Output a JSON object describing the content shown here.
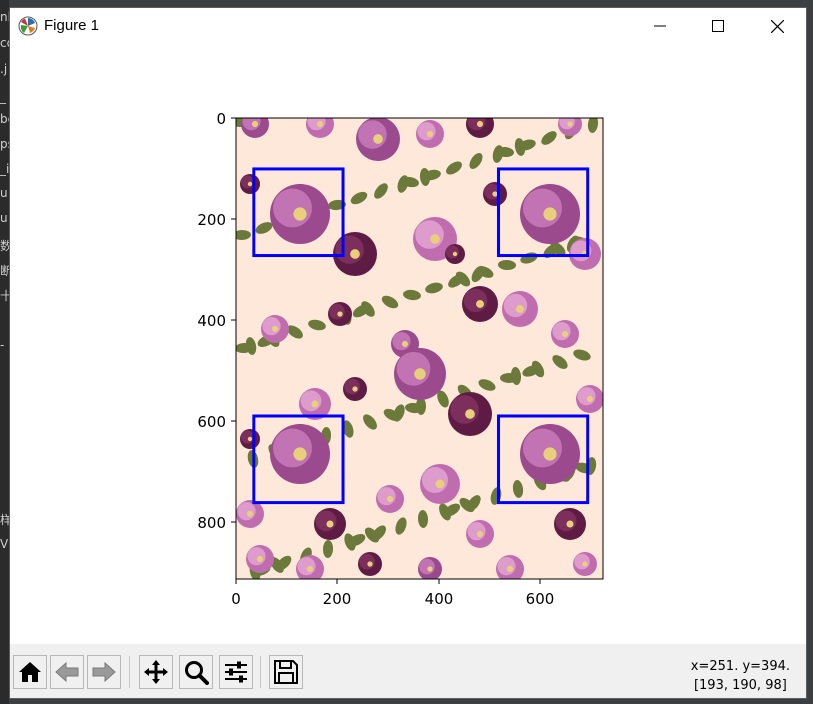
{
  "window": {
    "title": "Figure 1",
    "controls": {
      "minimize": "minimize",
      "maximize": "maximize",
      "close": "close"
    }
  },
  "background": {
    "left_fragments": [
      "nl",
      "co",
      ".j",
      "_",
      "be",
      "ps",
      "_i",
      "u",
      "u",
      "数",
      "断",
      "十",
      "-",
      "样",
      "V"
    ]
  },
  "toolbar": {
    "buttons": [
      {
        "name": "home",
        "icon": "home-icon"
      },
      {
        "name": "back",
        "icon": "left-arrow-icon"
      },
      {
        "name": "forward",
        "icon": "right-arrow-icon"
      },
      {
        "name": "pan",
        "icon": "move-icon"
      },
      {
        "name": "zoom",
        "icon": "magnifier-icon"
      },
      {
        "name": "configure-subplots",
        "icon": "sliders-icon"
      },
      {
        "name": "save",
        "icon": "floppy-disk-icon"
      }
    ],
    "coords_line1": "x=251. y=394.",
    "coords_line2": "[193, 190, 98]"
  },
  "plot": {
    "x_ticks": [
      "0",
      "200",
      "400",
      "600"
    ],
    "y_ticks": [
      "0",
      "200",
      "400",
      "600",
      "800"
    ],
    "x_range": [
      0,
      720
    ],
    "y_range": [
      0,
      905
    ],
    "image_background": "#fde8da",
    "box_color": "#0000ff",
    "rectangles": [
      {
        "x": 35,
        "y": 100,
        "w": 175,
        "h": 170
      },
      {
        "x": 515,
        "y": 100,
        "w": 175,
        "h": 170
      },
      {
        "x": 35,
        "y": 585,
        "w": 175,
        "h": 170
      },
      {
        "x": 515,
        "y": 585,
        "w": 175,
        "h": 170
      }
    ]
  }
}
